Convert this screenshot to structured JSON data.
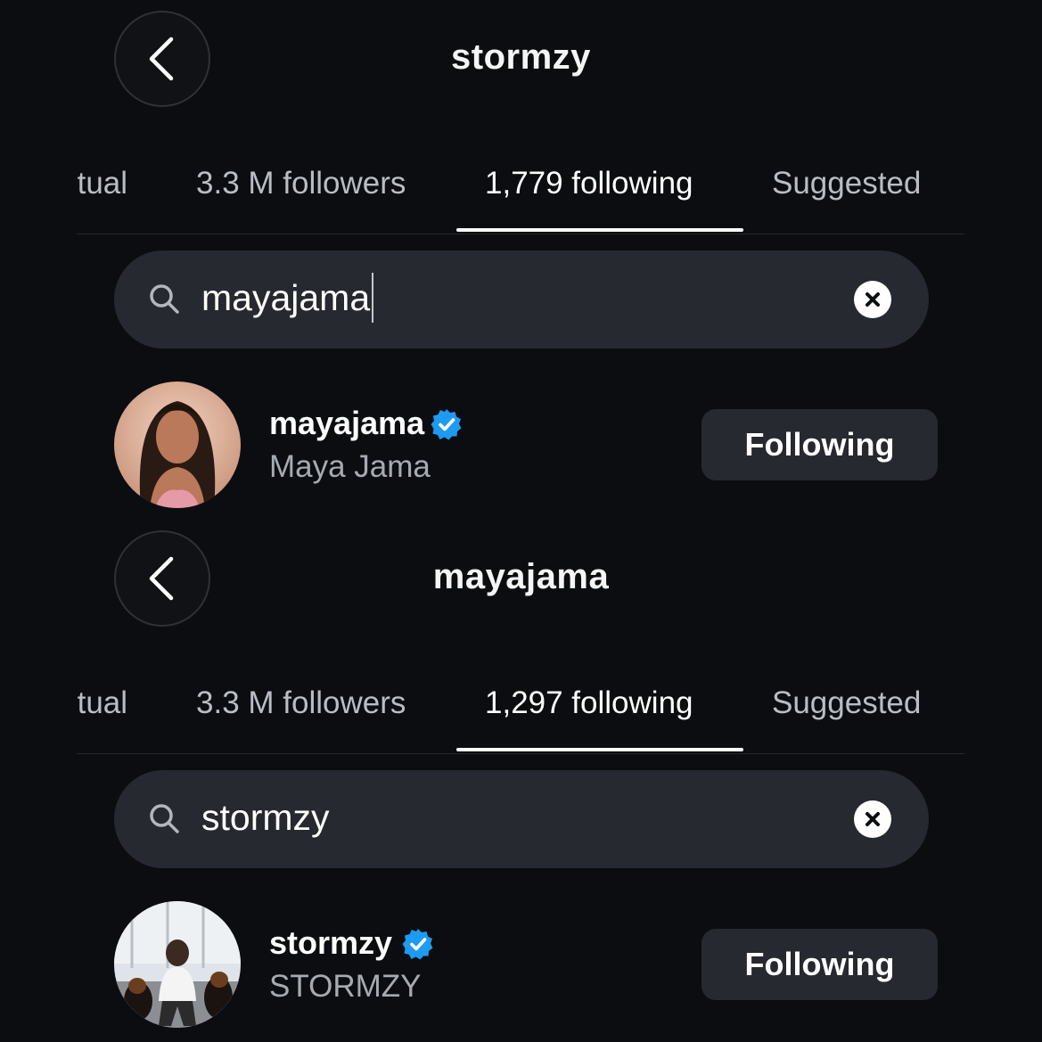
{
  "colors": {
    "background": "#0b0d11",
    "surface": "#26292f",
    "verified": "#1d9bf0",
    "muted_text": "#a6aab1"
  },
  "screens": [
    {
      "title": "stormzy",
      "tabs": [
        "mutual",
        "3.3 M followers",
        "1,779 following",
        "Suggested"
      ],
      "active_tab": "1,779 following",
      "search": {
        "value": "mayajama",
        "icon": "search-icon",
        "clear_icon": "close-circle-icon"
      },
      "result": {
        "username": "mayajama",
        "full_name": "Maya Jama",
        "verified": true,
        "button_label": "Following"
      }
    },
    {
      "title": "mayajama",
      "tabs": [
        "mutual",
        "3.3 M followers",
        "1,297 following",
        "Suggested"
      ],
      "active_tab": "1,297 following",
      "search": {
        "value": "stormzy",
        "icon": "search-icon",
        "clear_icon": "close-circle-icon"
      },
      "result": {
        "username": "stormzy",
        "full_name": "STORMZY",
        "verified": true,
        "button_label": "Following"
      }
    }
  ]
}
